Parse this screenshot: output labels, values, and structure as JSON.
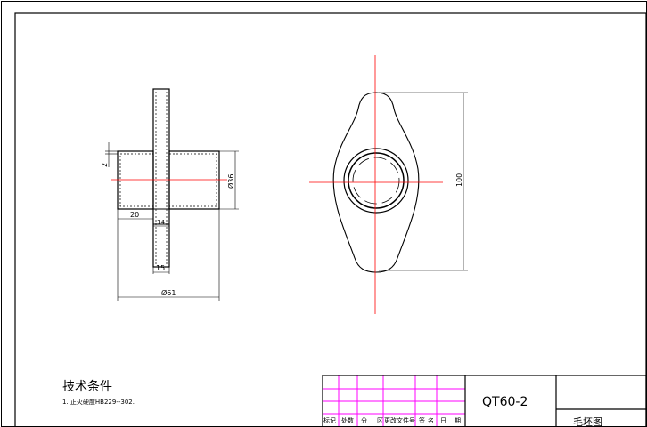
{
  "drawing": {
    "tech_heading": "技术条件",
    "tech_note": "1. 正火硬度HB229--302.",
    "dims": {
      "d2": "2",
      "d20": "20",
      "d14": "14",
      "d15": "15",
      "d61": "Ø61",
      "d36": "Ø36",
      "d100": "100"
    },
    "title_block": {
      "part_no": "QT60-2",
      "name": "毛坯图",
      "headers": [
        "标记",
        "处数",
        "分",
        "区",
        "更改文件号",
        "签名",
        "日",
        "期"
      ]
    }
  }
}
